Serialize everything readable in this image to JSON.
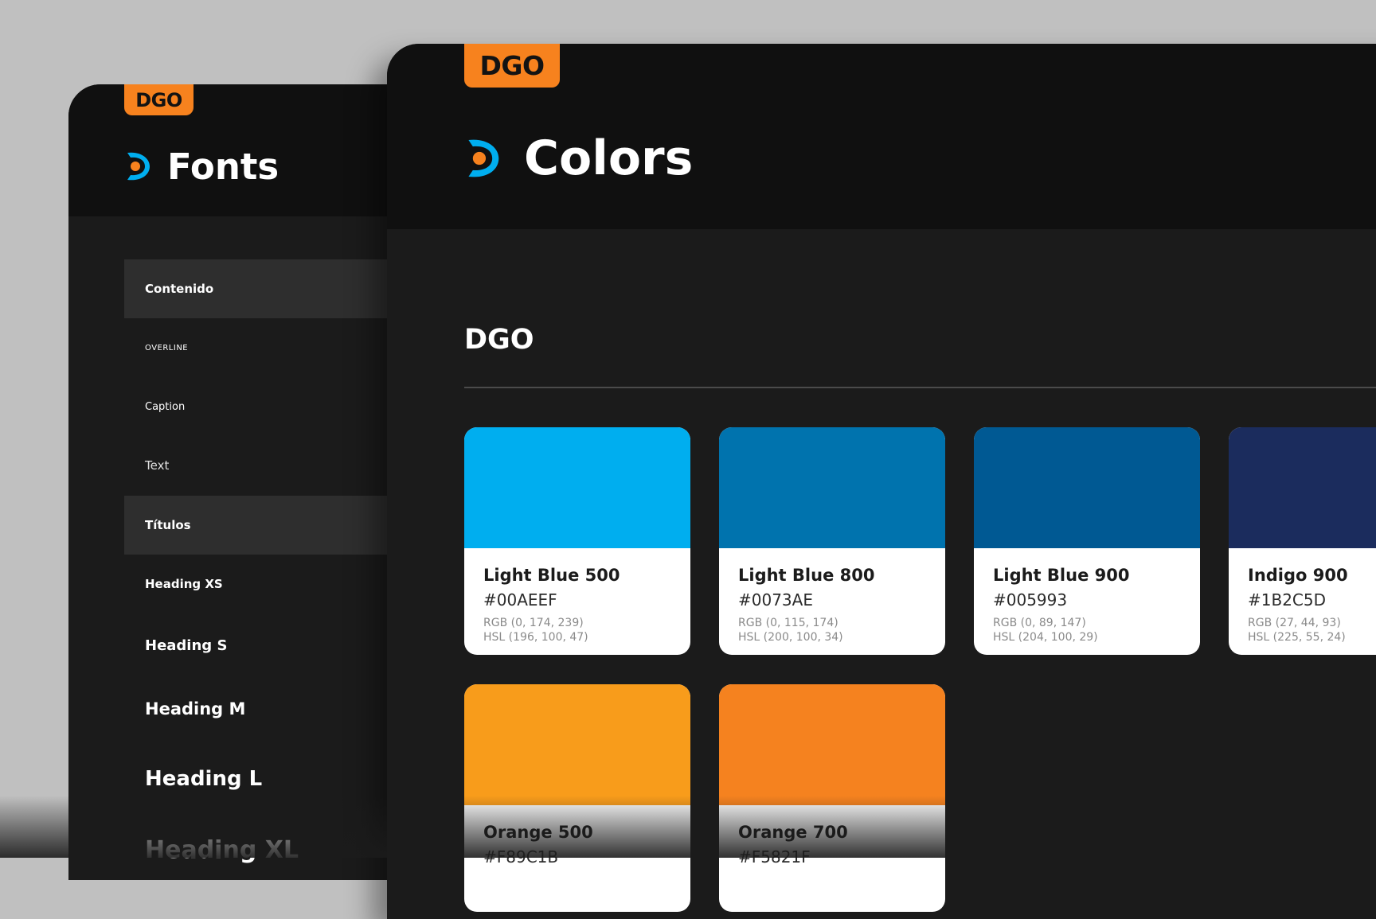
{
  "fonts_panel": {
    "badge": "DGO",
    "title": "Fonts",
    "nav_items": [
      {
        "label": "Contenido"
      },
      {
        "label": "OVERLINE"
      },
      {
        "label": "Caption"
      },
      {
        "label": "Text"
      },
      {
        "label": "Títulos"
      },
      {
        "label": "Heading XS"
      },
      {
        "label": "Heading S"
      },
      {
        "label": "Heading M"
      },
      {
        "label": "Heading L"
      },
      {
        "label": "Heading XL"
      }
    ]
  },
  "colors_panel": {
    "badge": "DGO",
    "title": "Colors",
    "section_title": "DGO",
    "swatches": [
      {
        "name": "Light Blue 500",
        "hex": "#00AEEF",
        "rgb": "RGB (0, 174, 239)",
        "hsl": "HSL  (196, 100, 47)",
        "color": "#00AEEF"
      },
      {
        "name": "Light Blue 800",
        "hex": "#0073AE",
        "rgb": "RGB (0, 115, 174)",
        "hsl": "HSL  (200, 100, 34)",
        "color": "#0073AE"
      },
      {
        "name": "Light Blue 900",
        "hex": "#005993",
        "rgb": "RGB (0, 89, 147)",
        "hsl": "HSL  (204, 100, 29)",
        "color": "#005993"
      },
      {
        "name": "Indigo 900",
        "hex": "#1B2C5D",
        "rgb": "RGB (27, 44, 93)",
        "hsl": "HSL  (225, 55, 24)",
        "color": "#1B2C5D"
      },
      {
        "name": "Orange 500",
        "hex": "#F89C1B",
        "rgb": "",
        "hsl": "",
        "color": "#F89C1B"
      },
      {
        "name": "Orange 700",
        "hex": "#F5821F",
        "rgb": "",
        "hsl": "",
        "color": "#F5821F"
      }
    ]
  },
  "colors": {
    "background": "#C0C0C0",
    "panel_header": "#101010",
    "panel_body": "#1B1B1B",
    "accent_orange": "#F7821E",
    "logo_blue": "#00AEEF"
  }
}
